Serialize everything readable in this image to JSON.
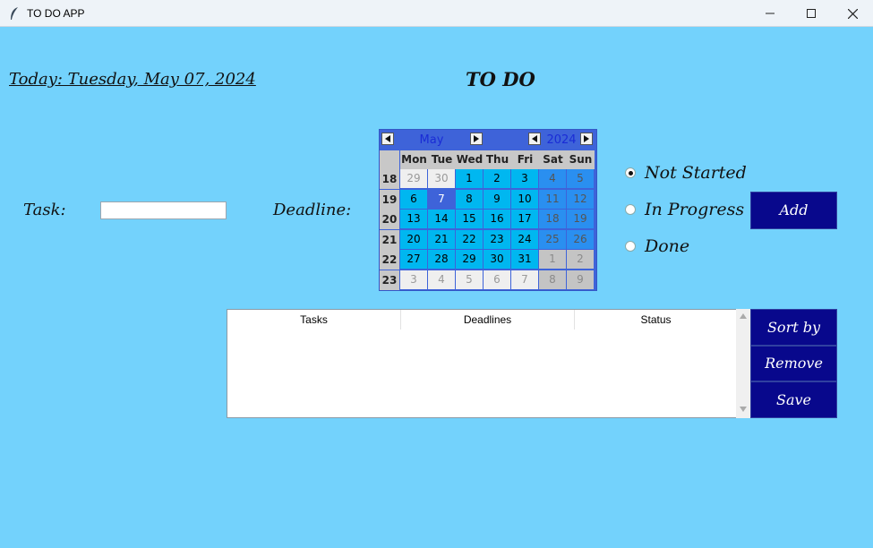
{
  "window": {
    "title": "TO DO APP"
  },
  "header": {
    "today": "Today: Tuesday, May 07, 2024",
    "title": "TO DO"
  },
  "form": {
    "task_label": "Task:",
    "task_value": "",
    "deadline_label": "Deadline:"
  },
  "calendar": {
    "month": "May",
    "year": "2024",
    "weekdays": [
      "Mon",
      "Tue",
      "Wed",
      "Thu",
      "Fri",
      "Sat",
      "Sun"
    ],
    "weeks": [
      {
        "num": "18",
        "days": [
          "29",
          "30",
          "1",
          "2",
          "3",
          "4",
          "5"
        ]
      },
      {
        "num": "19",
        "days": [
          "6",
          "7",
          "8",
          "9",
          "10",
          "11",
          "12"
        ]
      },
      {
        "num": "20",
        "days": [
          "13",
          "14",
          "15",
          "16",
          "17",
          "18",
          "19"
        ]
      },
      {
        "num": "21",
        "days": [
          "20",
          "21",
          "22",
          "23",
          "24",
          "25",
          "26"
        ]
      },
      {
        "num": "22",
        "days": [
          "27",
          "28",
          "29",
          "30",
          "31",
          "1",
          "2"
        ]
      },
      {
        "num": "23",
        "days": [
          "3",
          "4",
          "5",
          "6",
          "7",
          "8",
          "9"
        ]
      }
    ],
    "selected": "7"
  },
  "status": {
    "options": [
      {
        "label": "Not Started",
        "checked": true
      },
      {
        "label": "In Progress",
        "checked": false
      },
      {
        "label": "Done",
        "checked": false
      }
    ]
  },
  "buttons": {
    "add": "Add",
    "sort": "Sort by date",
    "remove": "Remove",
    "save": "Save"
  },
  "table": {
    "columns": [
      "Tasks",
      "Deadlines",
      "Status"
    ],
    "rows": []
  },
  "colors": {
    "background": "#73d2fc",
    "button": "#08088c",
    "calendar_header": "#3e63d9",
    "weekday_cell": "#00b7f0",
    "weekend_cell": "#2a8ff0"
  }
}
